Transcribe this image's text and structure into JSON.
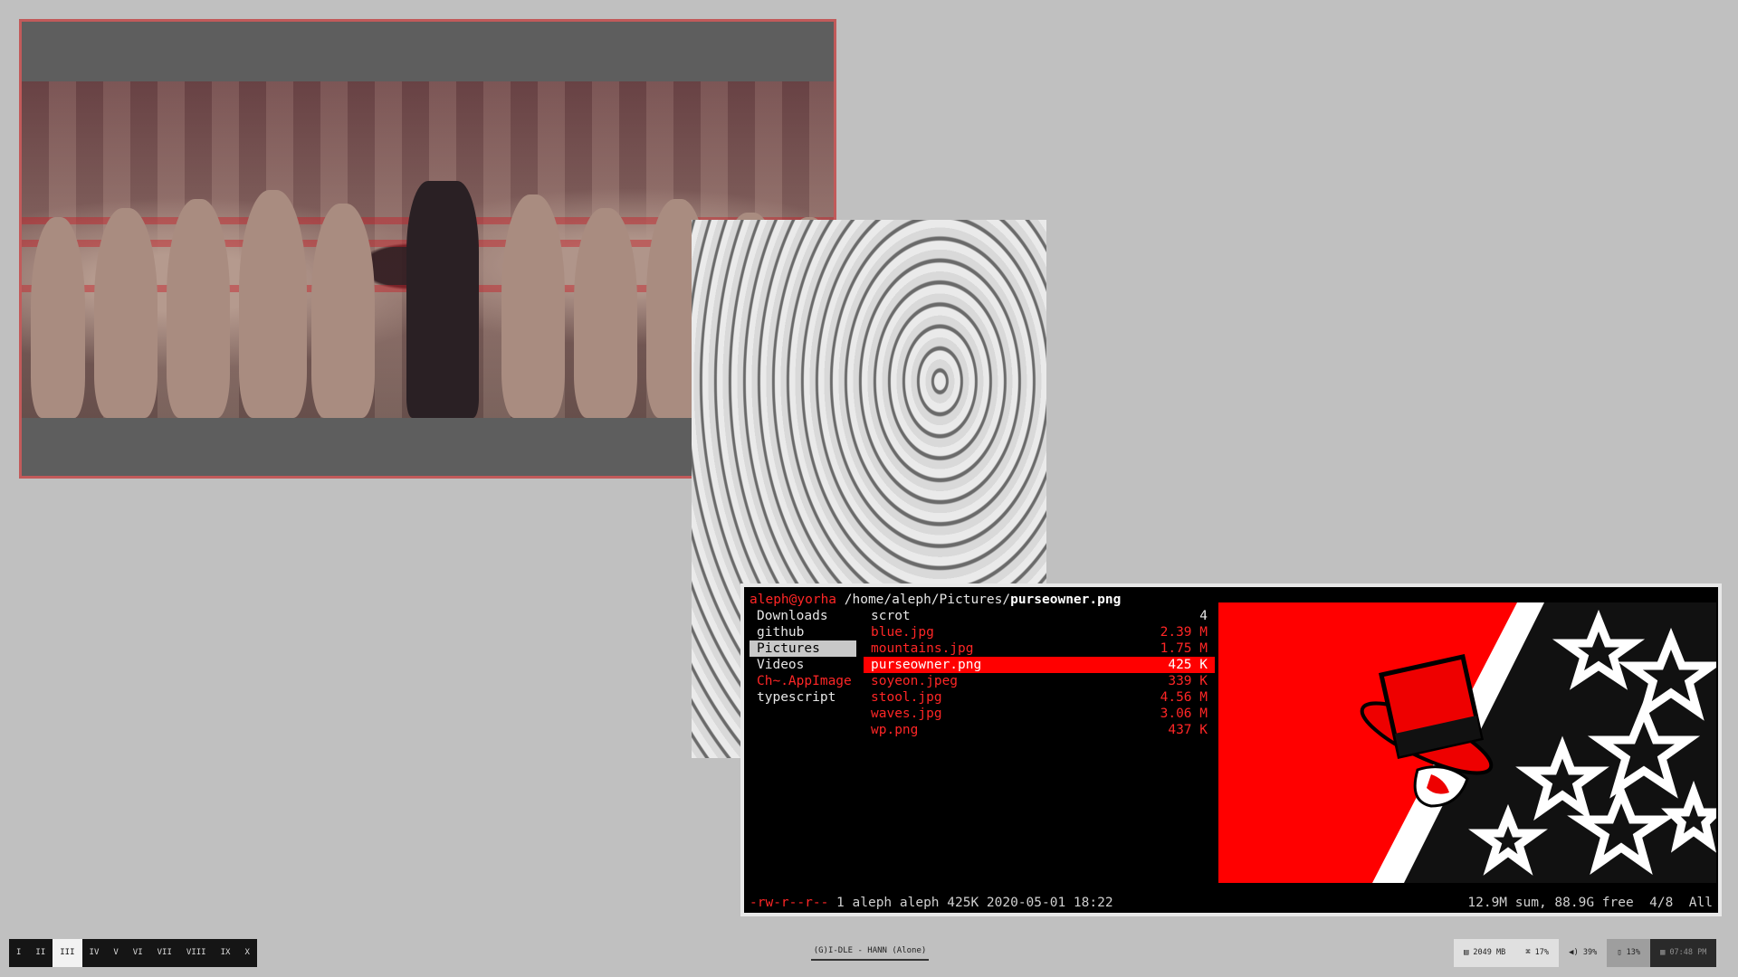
{
  "terminal": {
    "user_host": "aleph@yorha",
    "path_prefix": "/home/aleph/Pictures/",
    "path_file": "purseowner.png",
    "parent_dirs": [
      {
        "name": "Downloads",
        "state": "normal"
      },
      {
        "name": "github",
        "state": "normal"
      },
      {
        "name": "Pictures",
        "state": "selected"
      },
      {
        "name": "Videos",
        "state": "normal"
      },
      {
        "name": "Ch~.AppImage",
        "state": "executable"
      },
      {
        "name": "typescript",
        "state": "normal"
      }
    ],
    "files": [
      {
        "name": "scrot",
        "size": "4",
        "kind": "dir"
      },
      {
        "name": "blue.jpg",
        "size": "2.39 M",
        "kind": "file"
      },
      {
        "name": "mountains.jpg",
        "size": "1.75 M",
        "kind": "file"
      },
      {
        "name": "purseowner.png",
        "size": "425 K",
        "kind": "selected"
      },
      {
        "name": "soyeon.jpeg",
        "size": "339 K",
        "kind": "file"
      },
      {
        "name": "stool.jpg",
        "size": "4.56 M",
        "kind": "file"
      },
      {
        "name": "waves.jpg",
        "size": "3.06 M",
        "kind": "file"
      },
      {
        "name": "wp.png",
        "size": "437 K",
        "kind": "file"
      }
    ],
    "status_perms": "-rw-r--r--",
    "status_info": " 1 aleph aleph 425K 2020-05-01 18:22",
    "status_right": "12.9M sum, 88.9G free  4/8  All"
  },
  "workspaces": [
    {
      "label": "I",
      "active": false
    },
    {
      "label": "II",
      "active": false
    },
    {
      "label": "III",
      "active": true
    },
    {
      "label": "IV",
      "active": false
    },
    {
      "label": "V",
      "active": false
    },
    {
      "label": "VI",
      "active": false
    },
    {
      "label": "VII",
      "active": false
    },
    {
      "label": "VIII",
      "active": false
    },
    {
      "label": "IX",
      "active": false
    },
    {
      "label": "X",
      "active": false
    }
  ],
  "now_playing": "(G)I-DLE - HANN (Alone)",
  "status": {
    "memory": {
      "icon": "memory-icon",
      "value": "2049 MB"
    },
    "cpu": {
      "icon": "cpu-icon",
      "value": "17%"
    },
    "volume": {
      "icon": "volume-icon",
      "value": "39%"
    },
    "battery": {
      "icon": "battery-icon",
      "value": "13%"
    },
    "clock": {
      "icon": "calendar-icon",
      "value": "07:48 PM"
    }
  },
  "colors": {
    "accent_red": "#ff0000",
    "window_border": "#c25a5a",
    "desktop": "#c0c0c0"
  }
}
